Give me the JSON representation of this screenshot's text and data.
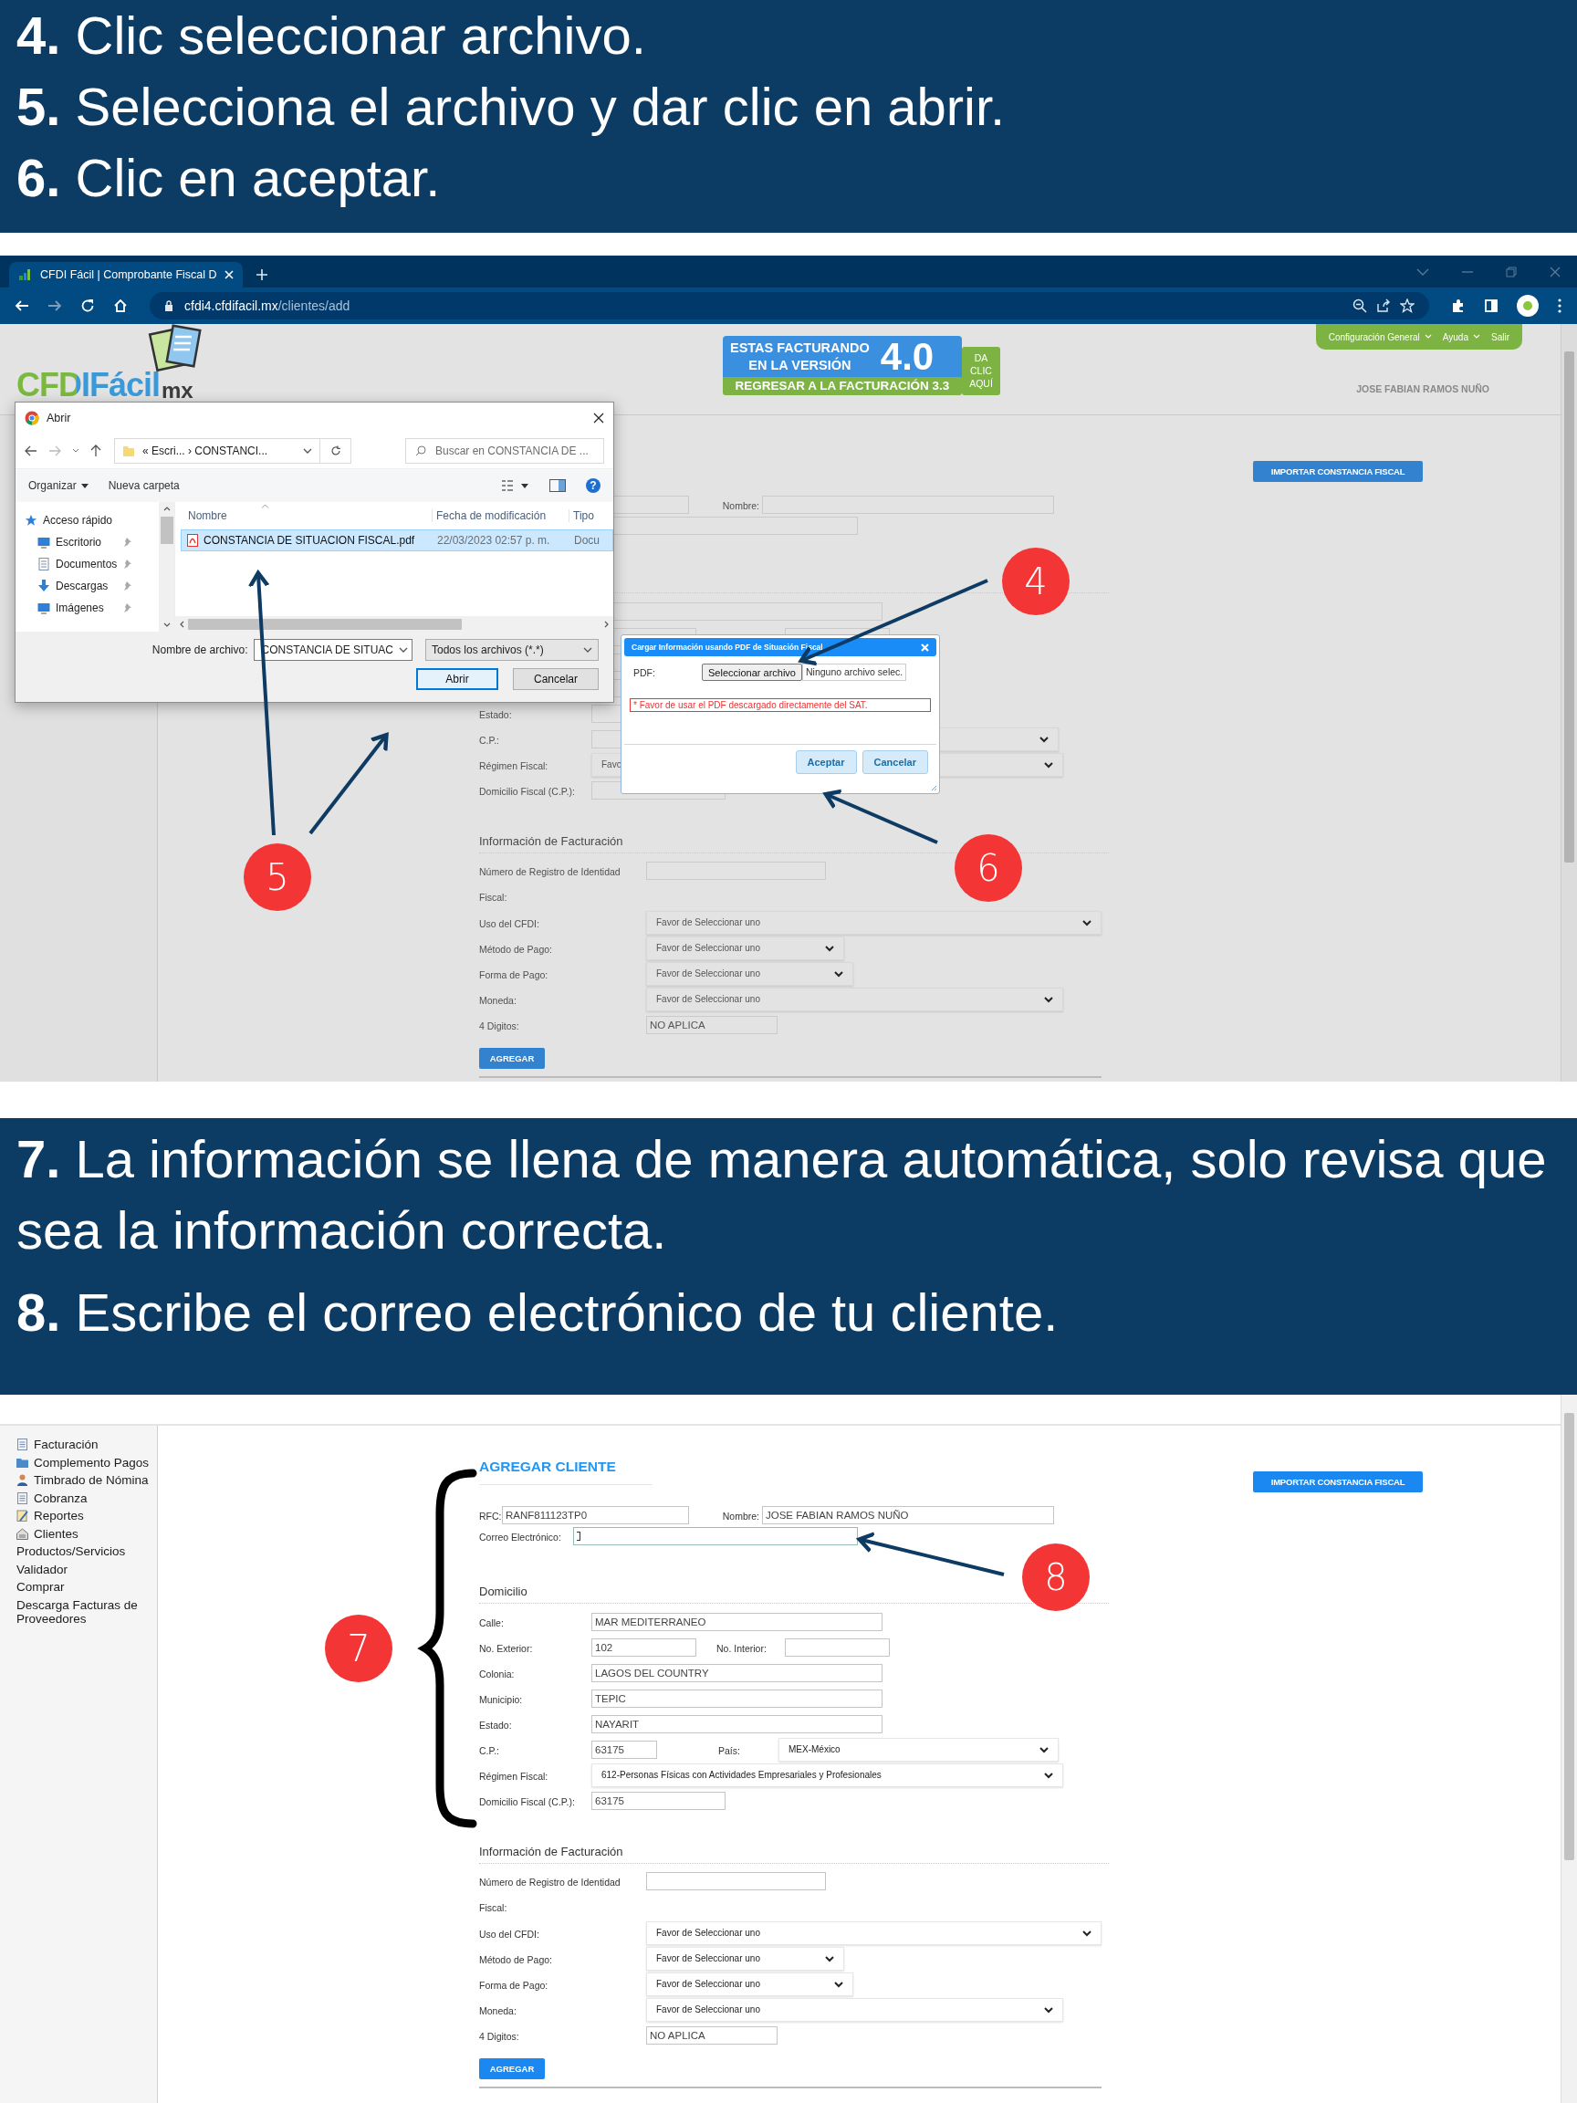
{
  "sections": [
    {
      "kind": "banner",
      "steps": [
        "**4.** Clic seleccionar archivo.",
        "**5.** Selecciona el archivo y dar clic en abrir.",
        "**6.** Clic en aceptar."
      ]
    },
    {
      "kind": "screenshot",
      "dimmed": true,
      "browser": {
        "tab_title": "CFDI Fácil | Comprobante Fiscal D",
        "url_host": "cfdi4.cfdifacil.mx",
        "url_path": "/clientes/add"
      },
      "header": {
        "logo": {
          "name": "CFDIFácil",
          "suffix": "mx"
        },
        "version": {
          "line_1": "ESTAS FACTURANDO",
          "line_2": "EN LA VERSIÓN",
          "number": "4.0",
          "back_link": "REGRESAR A LA FACTURACIÓN 3.3",
          "cta": "DA CLIC AQUÍ"
        },
        "menu": [
          {
            "label": "Configuración General",
            "dropdown": true
          },
          {
            "label": "Ayuda",
            "dropdown": true
          },
          {
            "label": "Salir",
            "dropdown": false
          }
        ],
        "user": "JOSE FABIAN RAMOS NUÑO"
      },
      "form": {
        "import_button": "IMPORTAR CONSTANCIA FISCAL",
        "nombre": {
          "label": "Nombre:"
        },
        "estado": {
          "label": "Estado:"
        },
        "cp": {
          "label": "C.P.:"
        },
        "regimen": {
          "label": "Régimen Fiscal:",
          "value": "Favo"
        },
        "domicilio_fiscal": {
          "label": "Domicilio Fiscal (C.P.):"
        },
        "facturacion_heading": "Información de Facturación",
        "registro": {
          "label": "Número de Registro de Identidad Fiscal:"
        },
        "uso_cfdi": {
          "label": "Uso del CFDI:",
          "value": "Favor de Seleccionar uno"
        },
        "metodo_pago": {
          "label": "Método de Pago:",
          "value": "Favor de Seleccionar uno"
        },
        "forma_pago": {
          "label": "Forma de Pago:",
          "value": "Favor de Seleccionar uno"
        },
        "moneda": {
          "label": "Moneda:",
          "value": "Favor de Seleccionar uno"
        },
        "digitos": {
          "label": "4 Digitos:",
          "value": "NO APLICA"
        },
        "submit": "AGREGAR"
      },
      "file_dialog": {
        "title": "Abrir",
        "breadcrumb": "« Escri... › CONSTANCI...",
        "search_placeholder": "Buscar en CONSTANCIA DE ...",
        "organize": "Organizar",
        "new_folder": "Nueva carpeta",
        "help": "?",
        "nav": [
          {
            "label": "Acceso rápido"
          },
          {
            "label": "Escritorio"
          },
          {
            "label": "Documentos"
          },
          {
            "label": "Descargas"
          },
          {
            "label": "Imágenes"
          }
        ],
        "columns": [
          "Nombre",
          "Fecha de modificación",
          "Tipo"
        ],
        "files": [
          {
            "name": "CONSTANCIA DE SITUACION FISCAL.pdf",
            "modified": "22/03/2023 02:57 p. m.",
            "type": "Docu",
            "selected": true
          }
        ],
        "filename_label": "Nombre de archivo:",
        "filename_value": "CONSTANCIA DE SITUAC",
        "file_type": "Todos los archivos (*.*)",
        "open_button": "Abrir",
        "cancel_button": "Cancelar"
      },
      "upload_modal": {
        "title": "Cargar Información usando PDF de Situación Fiscal",
        "pdf_label": "PDF:",
        "choose_button": "Seleccionar archivo",
        "file_status": "Ninguno archivo selec.",
        "warning": "* Favor de usar el PDF descargado directamente del SAT.",
        "buttons": [
          "Aceptar",
          "Cancelar"
        ]
      },
      "callouts": [
        {
          "number": "4"
        },
        {
          "number": "5"
        },
        {
          "number": "6"
        }
      ]
    },
    {
      "kind": "banner",
      "steps": [
        "**7.** La información se llena de manera automática, solo revisa que sea la información correcta.",
        "**8.** Escribe el correo electrónico de tu cliente."
      ]
    },
    {
      "kind": "screenshot",
      "dimmed": false,
      "sidebar": [
        {
          "label": "Facturación",
          "kind": "icon"
        },
        {
          "label": "Complemento Pagos",
          "kind": "icon"
        },
        {
          "label": "Timbrado de Nómina",
          "kind": "icon"
        },
        {
          "label": "Cobranza",
          "kind": "icon"
        },
        {
          "label": "Reportes",
          "kind": "icon"
        },
        {
          "label": "Clientes",
          "kind": "icon"
        },
        {
          "label": "Productos/Servicios",
          "kind": "plain"
        },
        {
          "label": "Validador",
          "kind": "plain"
        },
        {
          "label": "Comprar",
          "kind": "plain"
        },
        {
          "label": "Descarga Facturas de Proveedores",
          "kind": "plain"
        }
      ],
      "form": {
        "title": "AGREGAR CLIENTE",
        "import_button": "IMPORTAR CONSTANCIA FISCAL",
        "rfc": {
          "label": "RFC:",
          "value": "RANF811123TP0"
        },
        "nombre": {
          "label": "Nombre:",
          "value": "JOSE FABIAN RAMOS NUÑO"
        },
        "correo": {
          "label": "Correo Electrónico:",
          "focused": true
        },
        "domicilio_heading": "Domicilio",
        "calle": {
          "label": "Calle:",
          "value": "MAR MEDITERRANEO"
        },
        "no_exterior": {
          "label": "No. Exterior:",
          "value": "102"
        },
        "no_interior": {
          "label": "No. Interior:"
        },
        "colonia": {
          "label": "Colonia:",
          "value": "LAGOS DEL COUNTRY"
        },
        "municipio": {
          "label": "Municipio:",
          "value": "TEPIC"
        },
        "estado": {
          "label": "Estado:",
          "value": "NAYARIT"
        },
        "cp": {
          "label": "C.P.:",
          "value": "63175"
        },
        "pais": {
          "label": "País:",
          "value": "MEX-México"
        },
        "regimen": {
          "label": "Régimen Fiscal:",
          "value": "612-Personas Físicas con Actividades Empresariales y Profesionales"
        },
        "domicilio_fiscal": {
          "label": "Domicilio Fiscal (C.P.):",
          "value": "63175"
        },
        "facturacion_heading": "Información de Facturación",
        "registro": {
          "label": "Número de Registro de Identidad Fiscal:"
        },
        "uso_cfdi": {
          "label": "Uso del CFDI:",
          "value": "Favor de Seleccionar uno"
        },
        "metodo_pago": {
          "label": "Método de Pago:",
          "value": "Favor de Seleccionar uno"
        },
        "forma_pago": {
          "label": "Forma de Pago:",
          "value": "Favor de Seleccionar uno"
        },
        "moneda": {
          "label": "Moneda:",
          "value": "Favor de Seleccionar uno"
        },
        "digitos": {
          "label": "4 Digitos:",
          "value": "NO APLICA"
        },
        "submit": "AGREGAR"
      },
      "callouts": [
        {
          "number": "7"
        },
        {
          "number": "8"
        }
      ]
    }
  ]
}
